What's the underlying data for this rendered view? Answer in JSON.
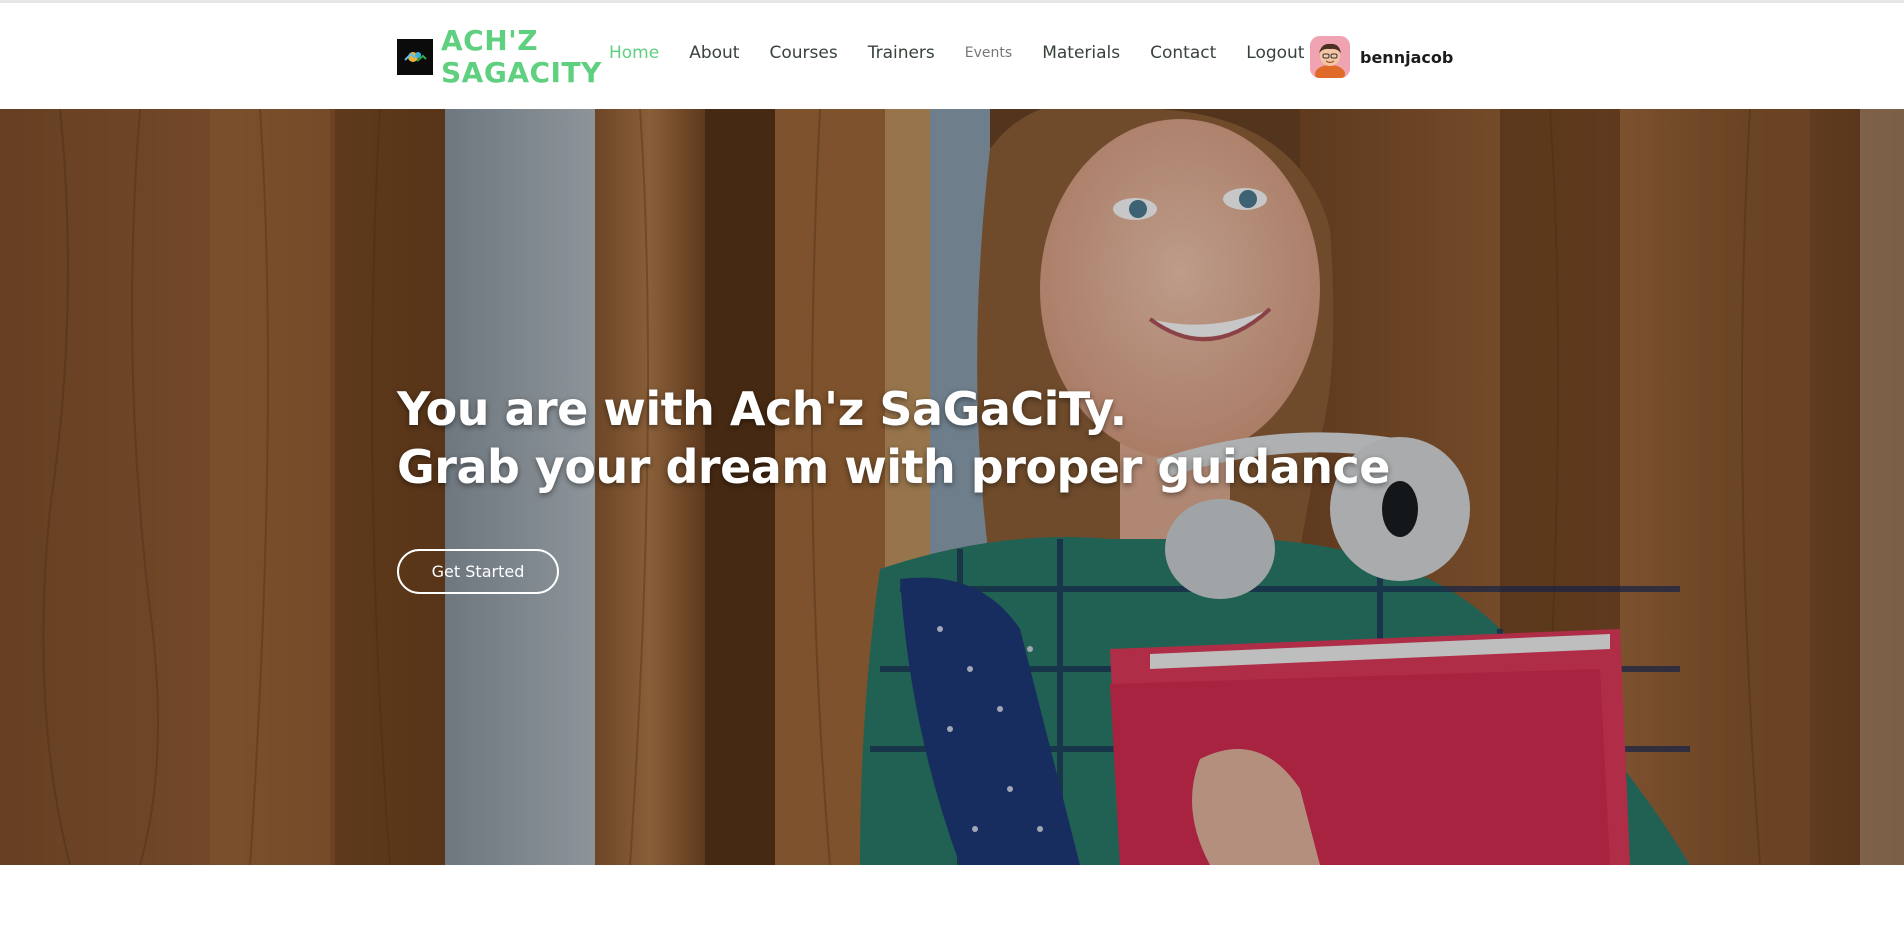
{
  "brand": {
    "name": "ACH'Z SAGACITY",
    "logo_icon": "logo-icon",
    "color": "#5fcf80"
  },
  "nav": {
    "items": [
      {
        "label": "Home",
        "active": true
      },
      {
        "label": "About"
      },
      {
        "label": "Courses"
      },
      {
        "label": "Trainers"
      },
      {
        "label": "Events"
      },
      {
        "label": "Materials"
      },
      {
        "label": "Contact"
      },
      {
        "label": "Logout"
      }
    ]
  },
  "user": {
    "name": "bennjacob",
    "avatar_icon": "avatar-icon"
  },
  "hero": {
    "line1": "You are with Ach'z SaGaCiTy.",
    "line2": "Grab your dream with proper guidance",
    "cta_label": "Get Started",
    "background_icon": "student-photo"
  },
  "colors": {
    "accent": "#5fcf80",
    "text": "#37423b"
  }
}
